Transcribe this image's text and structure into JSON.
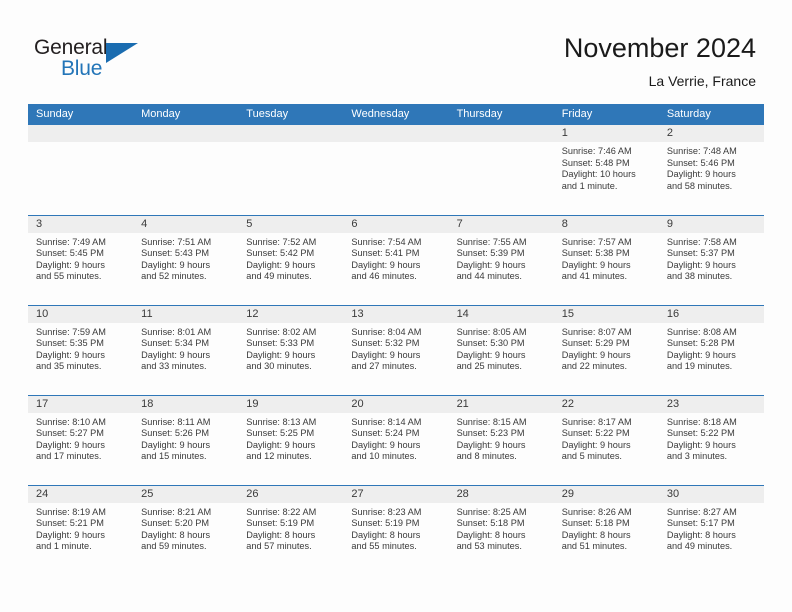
{
  "brand": {
    "name_part1": "General",
    "name_part2": "Blue",
    "triangle_icon": "triangle-icon",
    "accent_color": "#1a6cb0"
  },
  "header": {
    "title": "November 2024",
    "subtitle": "La Verrie, France"
  },
  "calendar": {
    "header_bg": "#2f77b8",
    "daynum_bg": "#eeeeee",
    "columns": [
      "Sunday",
      "Monday",
      "Tuesday",
      "Wednesday",
      "Thursday",
      "Friday",
      "Saturday"
    ],
    "weeks": [
      [
        {
          "day": "",
          "empty": true,
          "sunrise": "",
          "sunset": "",
          "daylight_line1": "",
          "daylight_line2": ""
        },
        {
          "day": "",
          "empty": true,
          "sunrise": "",
          "sunset": "",
          "daylight_line1": "",
          "daylight_line2": ""
        },
        {
          "day": "",
          "empty": true,
          "sunrise": "",
          "sunset": "",
          "daylight_line1": "",
          "daylight_line2": ""
        },
        {
          "day": "",
          "empty": true,
          "sunrise": "",
          "sunset": "",
          "daylight_line1": "",
          "daylight_line2": ""
        },
        {
          "day": "",
          "empty": true,
          "sunrise": "",
          "sunset": "",
          "daylight_line1": "",
          "daylight_line2": ""
        },
        {
          "day": "1",
          "empty": false,
          "sunrise": "Sunrise: 7:46 AM",
          "sunset": "Sunset: 5:48 PM",
          "daylight_line1": "Daylight: 10 hours",
          "daylight_line2": "and 1 minute."
        },
        {
          "day": "2",
          "empty": false,
          "sunrise": "Sunrise: 7:48 AM",
          "sunset": "Sunset: 5:46 PM",
          "daylight_line1": "Daylight: 9 hours",
          "daylight_line2": "and 58 minutes."
        }
      ],
      [
        {
          "day": "3",
          "empty": false,
          "sunrise": "Sunrise: 7:49 AM",
          "sunset": "Sunset: 5:45 PM",
          "daylight_line1": "Daylight: 9 hours",
          "daylight_line2": "and 55 minutes."
        },
        {
          "day": "4",
          "empty": false,
          "sunrise": "Sunrise: 7:51 AM",
          "sunset": "Sunset: 5:43 PM",
          "daylight_line1": "Daylight: 9 hours",
          "daylight_line2": "and 52 minutes."
        },
        {
          "day": "5",
          "empty": false,
          "sunrise": "Sunrise: 7:52 AM",
          "sunset": "Sunset: 5:42 PM",
          "daylight_line1": "Daylight: 9 hours",
          "daylight_line2": "and 49 minutes."
        },
        {
          "day": "6",
          "empty": false,
          "sunrise": "Sunrise: 7:54 AM",
          "sunset": "Sunset: 5:41 PM",
          "daylight_line1": "Daylight: 9 hours",
          "daylight_line2": "and 46 minutes."
        },
        {
          "day": "7",
          "empty": false,
          "sunrise": "Sunrise: 7:55 AM",
          "sunset": "Sunset: 5:39 PM",
          "daylight_line1": "Daylight: 9 hours",
          "daylight_line2": "and 44 minutes."
        },
        {
          "day": "8",
          "empty": false,
          "sunrise": "Sunrise: 7:57 AM",
          "sunset": "Sunset: 5:38 PM",
          "daylight_line1": "Daylight: 9 hours",
          "daylight_line2": "and 41 minutes."
        },
        {
          "day": "9",
          "empty": false,
          "sunrise": "Sunrise: 7:58 AM",
          "sunset": "Sunset: 5:37 PM",
          "daylight_line1": "Daylight: 9 hours",
          "daylight_line2": "and 38 minutes."
        }
      ],
      [
        {
          "day": "10",
          "empty": false,
          "sunrise": "Sunrise: 7:59 AM",
          "sunset": "Sunset: 5:35 PM",
          "daylight_line1": "Daylight: 9 hours",
          "daylight_line2": "and 35 minutes."
        },
        {
          "day": "11",
          "empty": false,
          "sunrise": "Sunrise: 8:01 AM",
          "sunset": "Sunset: 5:34 PM",
          "daylight_line1": "Daylight: 9 hours",
          "daylight_line2": "and 33 minutes."
        },
        {
          "day": "12",
          "empty": false,
          "sunrise": "Sunrise: 8:02 AM",
          "sunset": "Sunset: 5:33 PM",
          "daylight_line1": "Daylight: 9 hours",
          "daylight_line2": "and 30 minutes."
        },
        {
          "day": "13",
          "empty": false,
          "sunrise": "Sunrise: 8:04 AM",
          "sunset": "Sunset: 5:32 PM",
          "daylight_line1": "Daylight: 9 hours",
          "daylight_line2": "and 27 minutes."
        },
        {
          "day": "14",
          "empty": false,
          "sunrise": "Sunrise: 8:05 AM",
          "sunset": "Sunset: 5:30 PM",
          "daylight_line1": "Daylight: 9 hours",
          "daylight_line2": "and 25 minutes."
        },
        {
          "day": "15",
          "empty": false,
          "sunrise": "Sunrise: 8:07 AM",
          "sunset": "Sunset: 5:29 PM",
          "daylight_line1": "Daylight: 9 hours",
          "daylight_line2": "and 22 minutes."
        },
        {
          "day": "16",
          "empty": false,
          "sunrise": "Sunrise: 8:08 AM",
          "sunset": "Sunset: 5:28 PM",
          "daylight_line1": "Daylight: 9 hours",
          "daylight_line2": "and 19 minutes."
        }
      ],
      [
        {
          "day": "17",
          "empty": false,
          "sunrise": "Sunrise: 8:10 AM",
          "sunset": "Sunset: 5:27 PM",
          "daylight_line1": "Daylight: 9 hours",
          "daylight_line2": "and 17 minutes."
        },
        {
          "day": "18",
          "empty": false,
          "sunrise": "Sunrise: 8:11 AM",
          "sunset": "Sunset: 5:26 PM",
          "daylight_line1": "Daylight: 9 hours",
          "daylight_line2": "and 15 minutes."
        },
        {
          "day": "19",
          "empty": false,
          "sunrise": "Sunrise: 8:13 AM",
          "sunset": "Sunset: 5:25 PM",
          "daylight_line1": "Daylight: 9 hours",
          "daylight_line2": "and 12 minutes."
        },
        {
          "day": "20",
          "empty": false,
          "sunrise": "Sunrise: 8:14 AM",
          "sunset": "Sunset: 5:24 PM",
          "daylight_line1": "Daylight: 9 hours",
          "daylight_line2": "and 10 minutes."
        },
        {
          "day": "21",
          "empty": false,
          "sunrise": "Sunrise: 8:15 AM",
          "sunset": "Sunset: 5:23 PM",
          "daylight_line1": "Daylight: 9 hours",
          "daylight_line2": "and 8 minutes."
        },
        {
          "day": "22",
          "empty": false,
          "sunrise": "Sunrise: 8:17 AM",
          "sunset": "Sunset: 5:22 PM",
          "daylight_line1": "Daylight: 9 hours",
          "daylight_line2": "and 5 minutes."
        },
        {
          "day": "23",
          "empty": false,
          "sunrise": "Sunrise: 8:18 AM",
          "sunset": "Sunset: 5:22 PM",
          "daylight_line1": "Daylight: 9 hours",
          "daylight_line2": "and 3 minutes."
        }
      ],
      [
        {
          "day": "24",
          "empty": false,
          "sunrise": "Sunrise: 8:19 AM",
          "sunset": "Sunset: 5:21 PM",
          "daylight_line1": "Daylight: 9 hours",
          "daylight_line2": "and 1 minute."
        },
        {
          "day": "25",
          "empty": false,
          "sunrise": "Sunrise: 8:21 AM",
          "sunset": "Sunset: 5:20 PM",
          "daylight_line1": "Daylight: 8 hours",
          "daylight_line2": "and 59 minutes."
        },
        {
          "day": "26",
          "empty": false,
          "sunrise": "Sunrise: 8:22 AM",
          "sunset": "Sunset: 5:19 PM",
          "daylight_line1": "Daylight: 8 hours",
          "daylight_line2": "and 57 minutes."
        },
        {
          "day": "27",
          "empty": false,
          "sunrise": "Sunrise: 8:23 AM",
          "sunset": "Sunset: 5:19 PM",
          "daylight_line1": "Daylight: 8 hours",
          "daylight_line2": "and 55 minutes."
        },
        {
          "day": "28",
          "empty": false,
          "sunrise": "Sunrise: 8:25 AM",
          "sunset": "Sunset: 5:18 PM",
          "daylight_line1": "Daylight: 8 hours",
          "daylight_line2": "and 53 minutes."
        },
        {
          "day": "29",
          "empty": false,
          "sunrise": "Sunrise: 8:26 AM",
          "sunset": "Sunset: 5:18 PM",
          "daylight_line1": "Daylight: 8 hours",
          "daylight_line2": "and 51 minutes."
        },
        {
          "day": "30",
          "empty": false,
          "sunrise": "Sunrise: 8:27 AM",
          "sunset": "Sunset: 5:17 PM",
          "daylight_line1": "Daylight: 8 hours",
          "daylight_line2": "and 49 minutes."
        }
      ]
    ]
  }
}
